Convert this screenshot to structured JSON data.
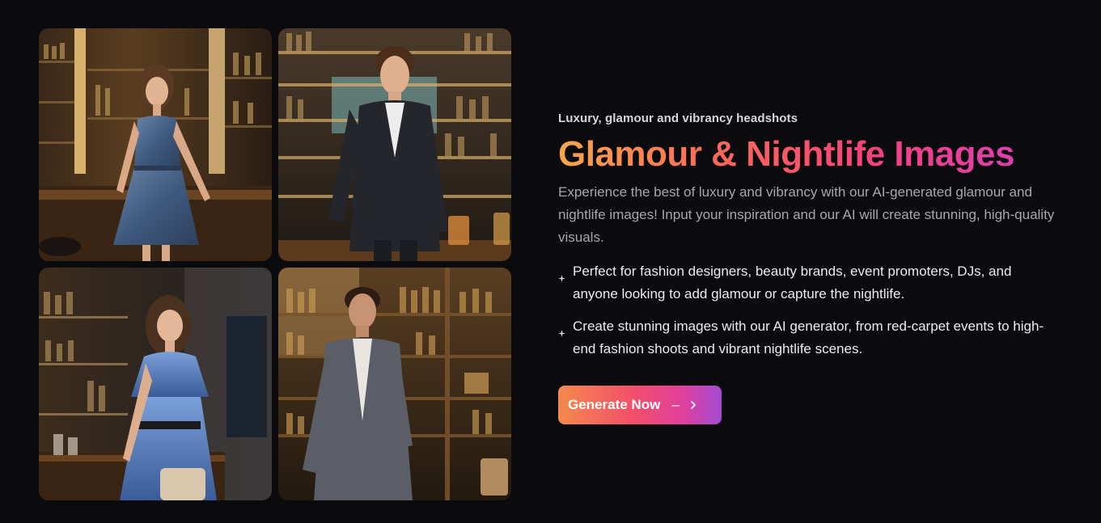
{
  "gallery": {
    "images": [
      {
        "name": "woman-blue-satin-dress-bar",
        "icon": "photo"
      },
      {
        "name": "man-dark-suit-bar",
        "icon": "photo"
      },
      {
        "name": "woman-blue-dress-belt-bar",
        "icon": "photo"
      },
      {
        "name": "man-grey-suit-bar",
        "icon": "photo"
      }
    ]
  },
  "section": {
    "eyebrow": "Luxury, glamour and vibrancy headshots",
    "title": "Glamour & Nightlife Images",
    "description": "Experience the best of luxury and vibrancy with our AI-generated glamour and nightlife images! Input your inspiration and our AI will create stunning, high-quality visuals.",
    "bullets": [
      {
        "text": "Perfect for fashion designers, beauty brands, event promoters, DJs, and anyone looking to add glamour or capture the nightlife.",
        "icon": "sparkle-icon"
      },
      {
        "text": "Create stunning images with our AI generator, from red-carpet events to high-end fashion shoots and vibrant nightlife scenes.",
        "icon": "sparkle-icon"
      }
    ],
    "cta": {
      "label": "Generate Now",
      "dash": "–",
      "icon": "chevron-right-icon"
    }
  },
  "colors": {
    "background": "#0b0a0d",
    "gradient_start": "#f6a64b",
    "gradient_mid": "#f7437a",
    "gradient_end": "#c843c0",
    "body_text": "#a9a6ad"
  }
}
